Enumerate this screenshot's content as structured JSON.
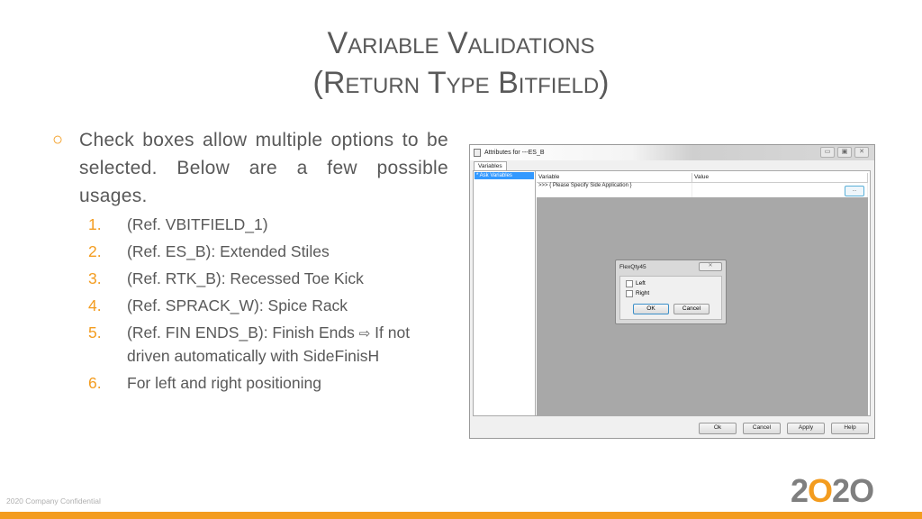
{
  "title": {
    "line1": "Variable Validations",
    "line2": "(Return Type Bitfield)"
  },
  "bullet": {
    "icon": "hollow-circle-bullet",
    "text": "Check boxes allow multiple options to be selected. Below are a few possible usages."
  },
  "items": [
    {
      "num": "1.",
      "text": "(Ref. VBITFIELD_1)"
    },
    {
      "num": "2.",
      "text": "(Ref. ES_B): Extended Stiles"
    },
    {
      "num": "3.",
      "text": "(Ref. RTK_B): Recessed Toe Kick"
    },
    {
      "num": "4.",
      "text": "(Ref. SPRACK_W): Spice Rack"
    },
    {
      "num": "5.",
      "text": "(Ref. FIN ENDS_B): Finish Ends",
      "arrow": "⇨",
      "text2": " If not driven automatically with SideFinisH"
    },
    {
      "num": "6.",
      "text": "For left and right positioning"
    }
  ],
  "window": {
    "title": "Attributes for ---ES_B",
    "controls": [
      "▭",
      "▣",
      "✕"
    ],
    "tab": "Variables",
    "tree_item": "* Ask Variables",
    "columns": [
      "Variable",
      "Value"
    ],
    "row": {
      "variable": ">>> { Please Specify Side Application }",
      "value": "",
      "button": "..."
    },
    "buttons": [
      "Ok",
      "Cancel",
      "Apply",
      "Help"
    ]
  },
  "dialog": {
    "title": "FlexQty45",
    "close": "✕",
    "options": [
      "Left",
      "Right"
    ],
    "ok": "OK",
    "cancel": "Cancel"
  },
  "footer": {
    "confidential": "2020 Company Confidential"
  },
  "logo": {
    "a": "2",
    "o": "O",
    "b": "2",
    "c": "O"
  },
  "colors": {
    "accent": "#f39c1f",
    "text": "#595959"
  }
}
